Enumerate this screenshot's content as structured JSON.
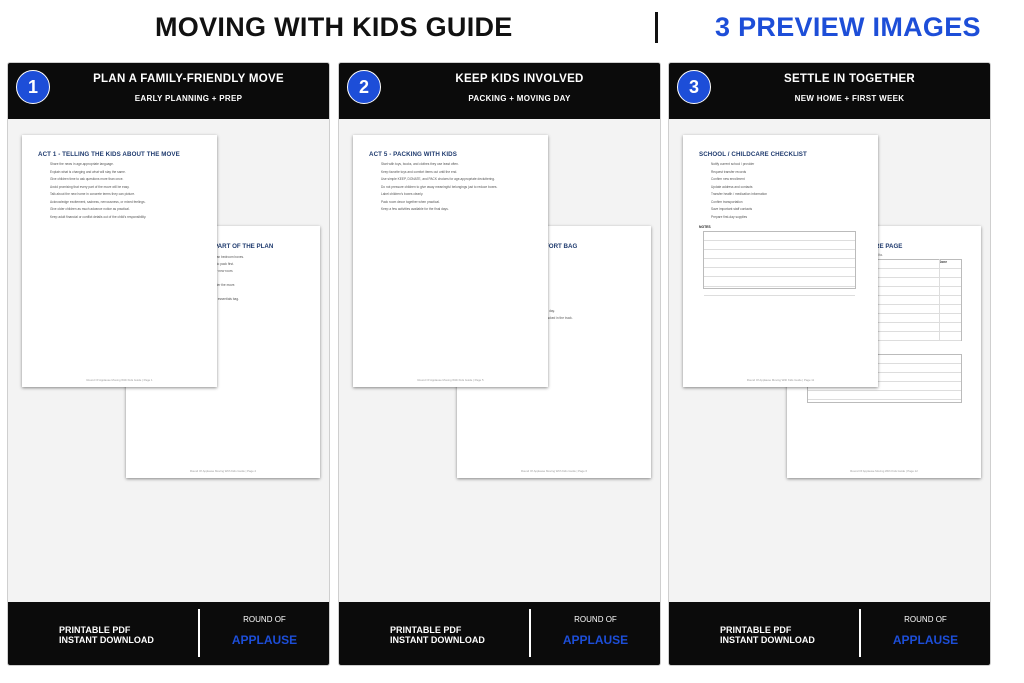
{
  "header": {
    "title": "MOVING WITH KIDS GUIDE",
    "right": "3 PREVIEW IMAGES"
  },
  "footer": {
    "line1": "PRINTABLE PDF",
    "line2": "INSTANT DOWNLOAD",
    "brand_top": "ROUND OF",
    "brand": "APPLAUSE"
  },
  "colors": {
    "accent": "#1d4ed8",
    "bar": "#0b0b0b",
    "heading": "#1e3a6e"
  },
  "panels": [
    {
      "num": "1",
      "title": "PLAN A FAMILY-FRIENDLY MOVE",
      "subtitle": "EARLY PLANNING + PREP",
      "front_heading": "ACT 1 - TELLING THE KIDS ABOUT THE MOVE",
      "front_lines": [
        "Share the news in age-appropriate language.",
        "Explain what is changing and what will stay the same.",
        "Give children time to ask questions more than once.",
        "Avoid promising that every part of the move will be easy.",
        "Talk about the new home in concrete terms they can picture.",
        "Acknowledge excitement, sadness, nervousness, or mixed feelings.",
        "Give older children as much advance notice as practical.",
        "Keep adult financial or conflict details out of the child's responsibility."
      ],
      "front_footer": "Round Of Applause Moving With Kids Guide | Page 1",
      "back_heading": "PART OF THE PLAN",
      "back_frags": [
        "than bedroom boxes.",
        "d to pack first.",
        "eir new room.",
        "after the move.",
        "or essentials bag."
      ],
      "back_footer": "Round Of Applause Moving With Kids Guide | Page 2"
    },
    {
      "num": "2",
      "title": "KEEP KIDS INVOLVED",
      "subtitle": "PACKING + MOVING DAY",
      "front_heading": "ACT 5 - PACKING WITH KIDS",
      "front_lines": [
        "Start with toys, books, and clothes they use least often.",
        "Keep favorite toys and comfort items out until the end.",
        "Use simple KEEP, DONATE, and PACK choices for age-appropriate decluttering.",
        "Do not pressure children to give away meaningful belongings just to reduce boxes.",
        "Label children's boxes clearly.",
        "Pack room decor together when practical.",
        "Keep a few activities available for the final days."
      ],
      "front_footer": "Round Of Applause Moving With Kids Guide | Page 5",
      "back_heading": "FORT BAG",
      "back_frags": [
        "ull day.",
        "packed in the truck."
      ],
      "back_footer": "Round Of Applause Moving With Kids Guide | Page 6"
    },
    {
      "num": "3",
      "title": "SETTLE IN TOGETHER",
      "subtitle": "NEW HOME + FIRST WEEK",
      "front_heading": "SCHOOL / CHILDCARE CHECKLIST",
      "front_lines": [
        "Notify current school / provider",
        "Request transfer records",
        "Confirm new enrollment",
        "Update address and contacts",
        "Transfer health / medication information",
        "Confirm transportation",
        "Save important staff contacts",
        "Prepare first-day supplies"
      ],
      "notes_label": "NOTES",
      "front_footer": "Round Of Applause Moving With Kids Guide | Page 11",
      "back_heading": "RE PAGE",
      "back_frags": [
        "ed to."
      ],
      "back_col": "Done",
      "back_footer": "Round Of Applause Moving With Kids Guide | Page 12"
    }
  ]
}
